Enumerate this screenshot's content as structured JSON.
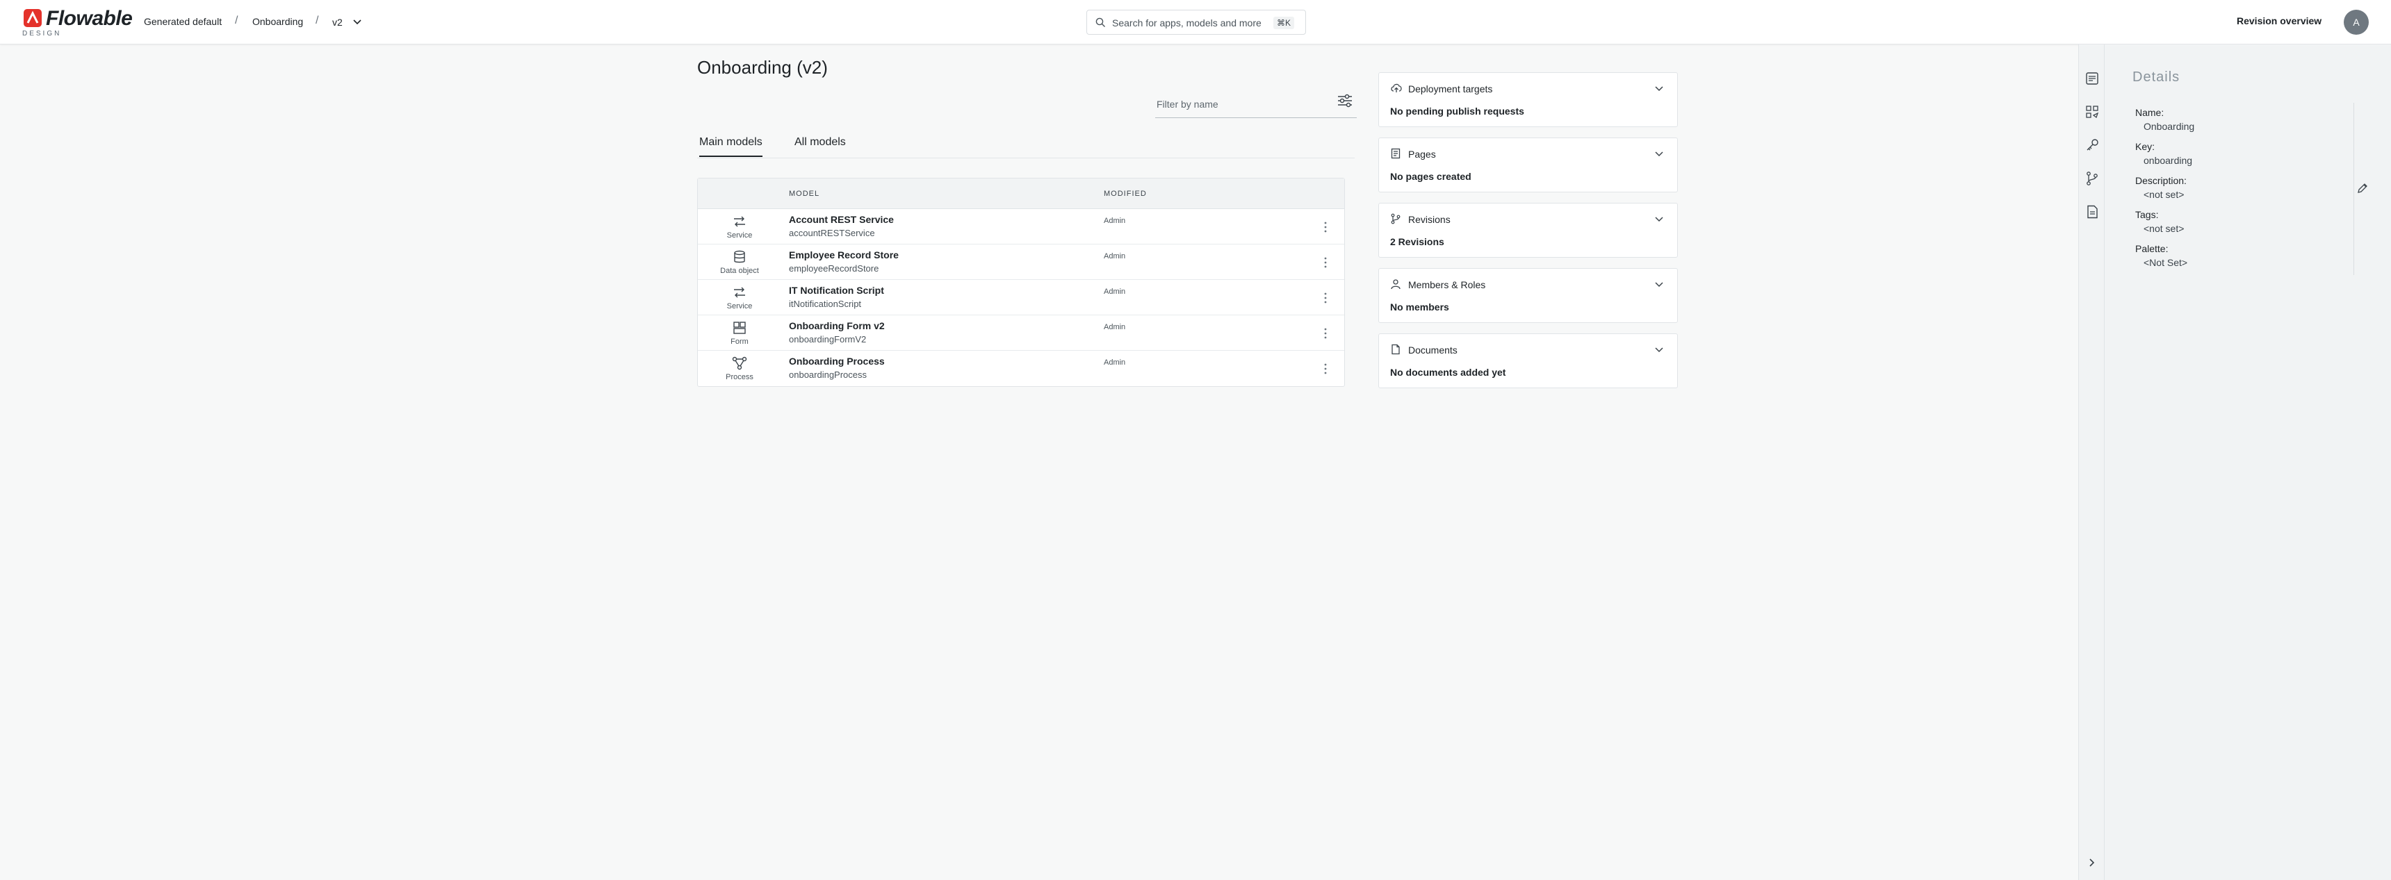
{
  "header": {
    "logo_word": "Flowable",
    "logo_sub": "DESIGN",
    "breadcrumbs": [
      {
        "label": "Generated default"
      },
      {
        "label": "Onboarding"
      }
    ],
    "breadcrumb_sep": "/",
    "version": "v2",
    "search_placeholder": "Search for apps, models and more",
    "search_shortcut": "⌘K",
    "revision_overview": "Revision overview",
    "avatar_initial": "A"
  },
  "main": {
    "title": "Onboarding (v2)",
    "filter_placeholder": "Filter by name",
    "tabs": [
      {
        "label": "Main models",
        "active": true
      },
      {
        "label": "All models",
        "active": false
      }
    ],
    "table": {
      "col_model": "MODEL",
      "col_modified": "MODIFIED",
      "rows": [
        {
          "type": "Service",
          "icon": "service-icon",
          "name": "Account REST Service",
          "key": "accountRESTService",
          "modified": "Admin"
        },
        {
          "type": "Data object",
          "icon": "data-object-icon",
          "name": "Employee Record Store",
          "key": "employeeRecordStore",
          "modified": "Admin"
        },
        {
          "type": "Service",
          "icon": "service-icon",
          "name": "IT Notification Script",
          "key": "itNotificationScript",
          "modified": "Admin"
        },
        {
          "type": "Form",
          "icon": "form-icon",
          "name": "Onboarding Form v2",
          "key": "onboardingFormV2",
          "modified": "Admin"
        },
        {
          "type": "Process",
          "icon": "process-icon",
          "name": "Onboarding Process",
          "key": "onboardingProcess",
          "modified": "Admin"
        }
      ]
    }
  },
  "cards": [
    {
      "icon": "cloud-upload-icon",
      "title": "Deployment targets",
      "body": "No pending publish requests"
    },
    {
      "icon": "page-icon",
      "title": "Pages",
      "body": "No pages created"
    },
    {
      "icon": "branch-icon",
      "title": "Revisions",
      "body": "2 Revisions"
    },
    {
      "icon": "user-icon",
      "title": "Members & Roles",
      "body": "No members"
    },
    {
      "icon": "document-icon",
      "title": "Documents",
      "body": "No documents added yet"
    }
  ],
  "details": {
    "title": "Details",
    "fields": [
      {
        "label": "Name:",
        "value": "Onboarding"
      },
      {
        "label": "Key:",
        "value": "onboarding"
      },
      {
        "label": "Description:",
        "value": "<not set>"
      },
      {
        "label": "Tags:",
        "value": "<not set>"
      },
      {
        "label": "Palette:",
        "value": "<Not Set>"
      }
    ]
  },
  "colors": {
    "brand": "#e4322b",
    "text": "#1e2327",
    "muted": "#4b545b"
  }
}
